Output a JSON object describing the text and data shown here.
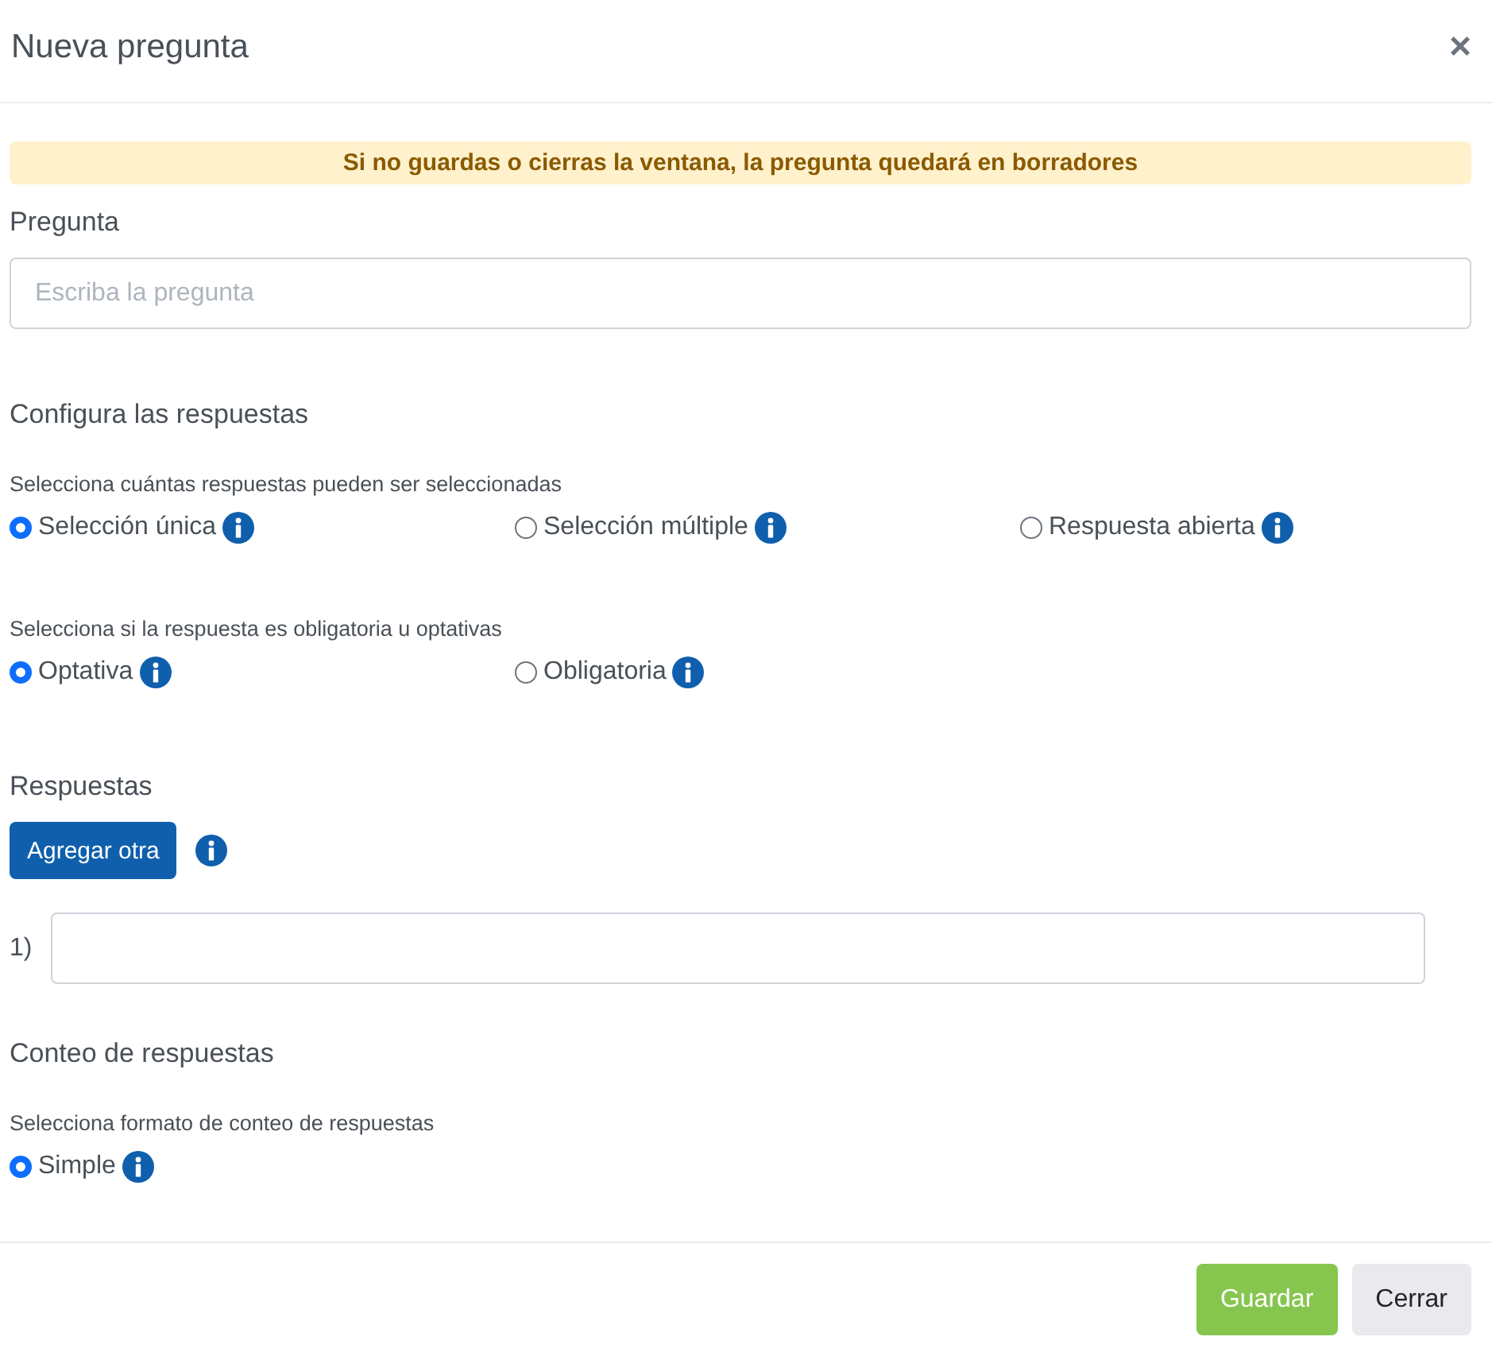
{
  "dialog": {
    "title": "Nueva pregunta",
    "close": "×"
  },
  "alert": "Si no guardas o cierras la ventana, la pregunta quedará en borradores",
  "question": {
    "label": "Pregunta",
    "placeholder": "Escriba la pregunta"
  },
  "config": {
    "title": "Configura las respuestas",
    "groups": [
      {
        "hint": "Selecciona cuántas respuestas pueden ser seleccionadas",
        "options": [
          {
            "label": "Selección única",
            "selected": true
          },
          {
            "label": "Selección múltiple",
            "selected": false
          },
          {
            "label": "Respuesta abierta",
            "selected": false
          }
        ]
      },
      {
        "hint": "Selecciona si la respuesta es obligatoria u optativas",
        "options": [
          {
            "label": "Optativa",
            "selected": true
          },
          {
            "label": "Obligatoria",
            "selected": false
          }
        ]
      }
    ]
  },
  "answers": {
    "title": "Respuestas",
    "add_button": "Agregar otra",
    "items": [
      {
        "number": "1)"
      }
    ]
  },
  "count": {
    "title": "Conteo de respuestas",
    "groups": [
      {
        "hint": "Selecciona formato de conteo de respuestas",
        "options": [
          {
            "label": "Simple",
            "selected": true
          }
        ]
      }
    ]
  },
  "footer": {
    "buttons": [
      {
        "label": "Guardar",
        "kind": "primary"
      },
      {
        "label": "Cerrar",
        "kind": "secondary"
      }
    ]
  }
}
